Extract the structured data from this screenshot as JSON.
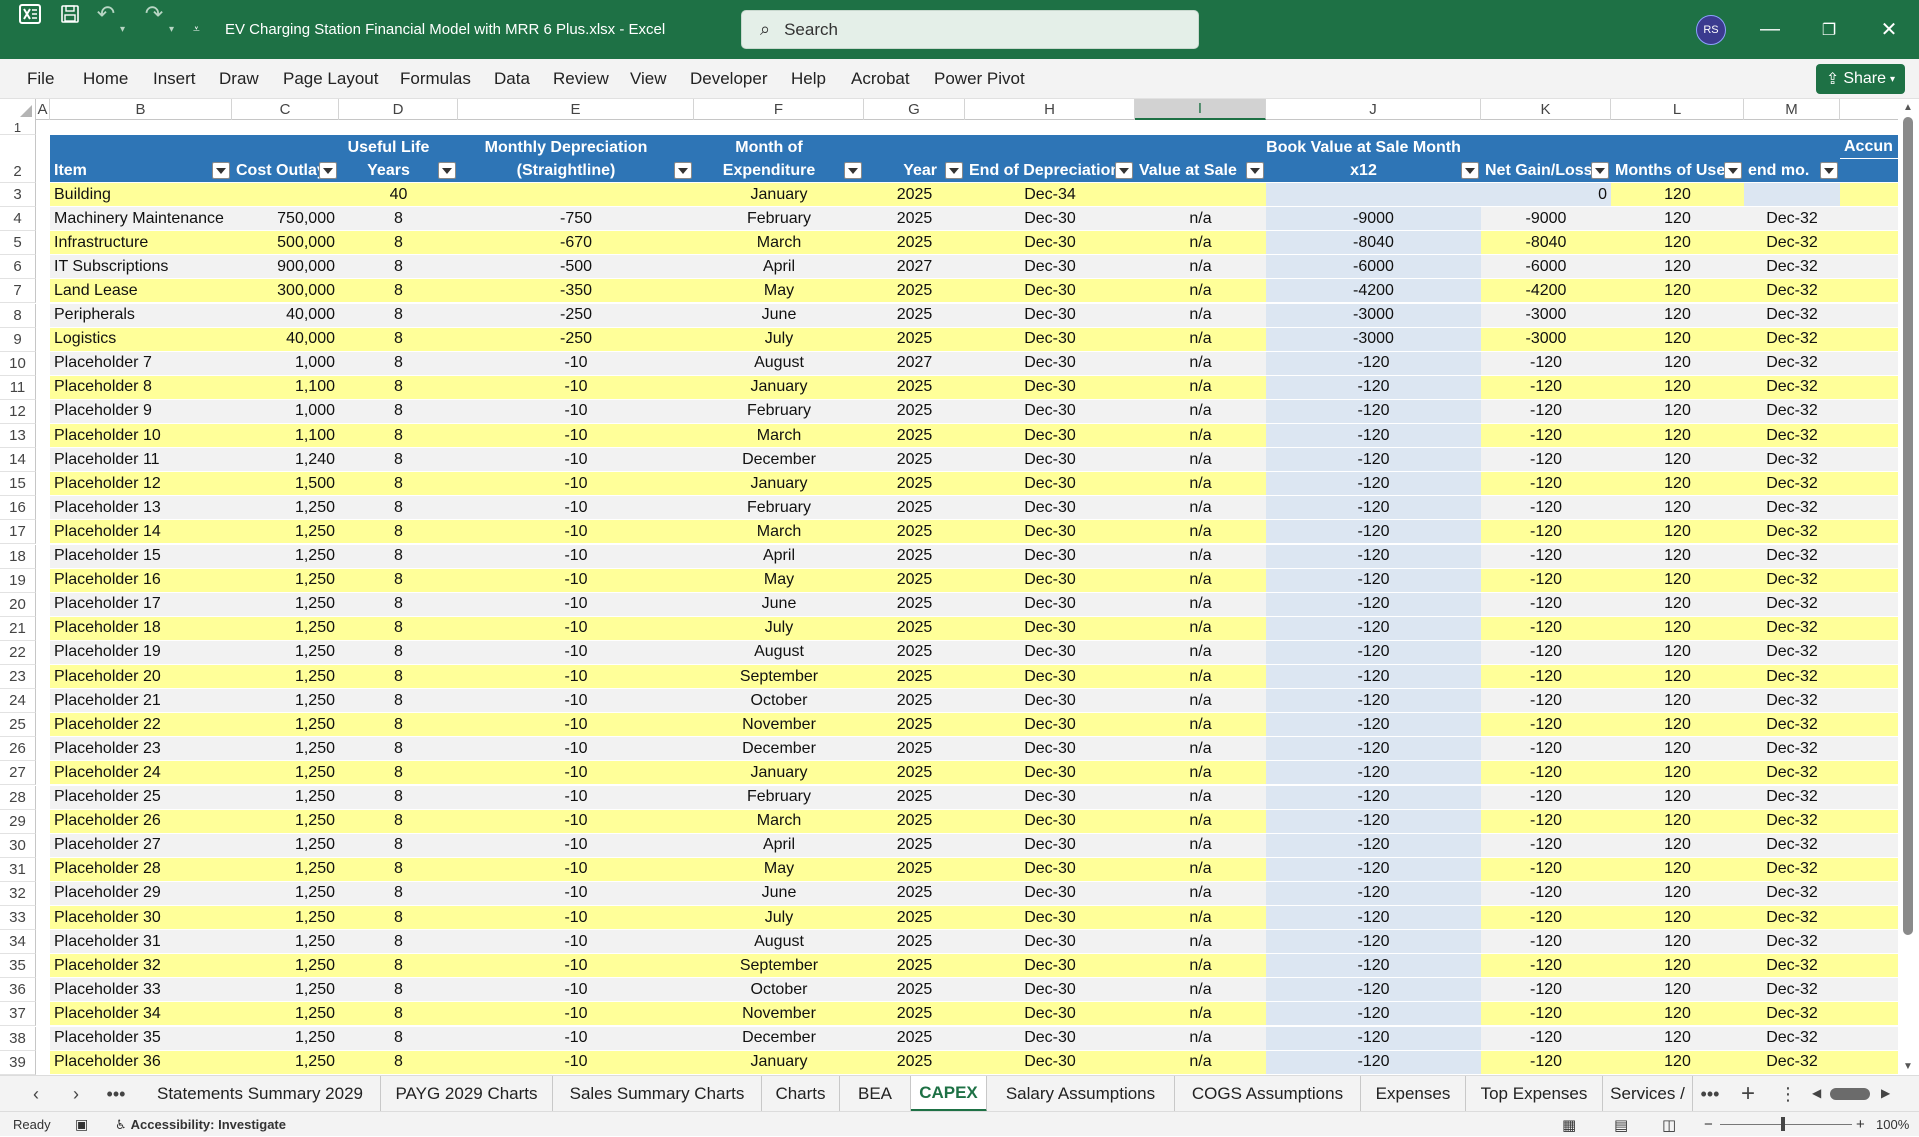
{
  "window": {
    "title": "EV Charging Station Financial Model with MRR 6 Plus.xlsx  -  Excel",
    "search_placeholder": "Search",
    "user_initials": "RS"
  },
  "menu": [
    "File",
    "Home",
    "Insert",
    "Draw",
    "Page Layout",
    "Formulas",
    "Data",
    "Review",
    "View",
    "Developer",
    "Help",
    "Acrobat",
    "Power Pivot"
  ],
  "share_label": "Share",
  "columns": [
    "A",
    "B",
    "C",
    "D",
    "E",
    "F",
    "G",
    "H",
    "I",
    "J",
    "K",
    "L",
    "M"
  ],
  "selected_column": "I",
  "header": {
    "item": "Item",
    "cost": "Cost Outlay",
    "life1": "Useful Life",
    "life2": "Years",
    "dep1": "Monthly Depreciation",
    "dep2": "(Straightline)",
    "month1": "Month of",
    "month2": "Expenditure",
    "year": "Year",
    "end": "End of Depreciation",
    "sale": "Value at Sale",
    "book1": "Book Value at Sale Month",
    "book2": "x12",
    "gain": "Net Gain/Loss",
    "months": "Months of Use",
    "endmo": "end mo.",
    "accum": "Accun"
  },
  "rows": [
    {
      "n": "3",
      "item": "Building",
      "cost": "",
      "life": "40",
      "dep": "",
      "month": "January",
      "year": "2025",
      "end": "Dec-34",
      "sale": "",
      "book": "",
      "gain": "0",
      "months": "120",
      "endmo": ""
    },
    {
      "n": "4",
      "item": "Machinery Maintenance",
      "cost": "750,000",
      "life": "8",
      "dep": "-750",
      "month": "February",
      "year": "2025",
      "end": "Dec-30",
      "sale": "n/a",
      "book": "-9000",
      "gain": "-9000",
      "months": "120",
      "endmo": "Dec-32"
    },
    {
      "n": "5",
      "item": "Infrastructure",
      "cost": "500,000",
      "life": "8",
      "dep": "-670",
      "month": "March",
      "year": "2025",
      "end": "Dec-30",
      "sale": "n/a",
      "book": "-8040",
      "gain": "-8040",
      "months": "120",
      "endmo": "Dec-32"
    },
    {
      "n": "6",
      "item": "IT Subscriptions",
      "cost": "900,000",
      "life": "8",
      "dep": "-500",
      "month": "April",
      "year": "2027",
      "end": "Dec-30",
      "sale": "n/a",
      "book": "-6000",
      "gain": "-6000",
      "months": "120",
      "endmo": "Dec-32"
    },
    {
      "n": "7",
      "item": "Land Lease",
      "cost": "300,000",
      "life": "8",
      "dep": "-350",
      "month": "May",
      "year": "2025",
      "end": "Dec-30",
      "sale": "n/a",
      "book": "-4200",
      "gain": "-4200",
      "months": "120",
      "endmo": "Dec-32"
    },
    {
      "n": "8",
      "item": "Peripherals",
      "cost": "40,000",
      "life": "8",
      "dep": "-250",
      "month": "June",
      "year": "2025",
      "end": "Dec-30",
      "sale": "n/a",
      "book": "-3000",
      "gain": "-3000",
      "months": "120",
      "endmo": "Dec-32"
    },
    {
      "n": "9",
      "item": "Logistics",
      "cost": "40,000",
      "life": "8",
      "dep": "-250",
      "month": "July",
      "year": "2025",
      "end": "Dec-30",
      "sale": "n/a",
      "book": "-3000",
      "gain": "-3000",
      "months": "120",
      "endmo": "Dec-32"
    },
    {
      "n": "10",
      "item": "Placeholder 7",
      "cost": "1,000",
      "life": "8",
      "dep": "-10",
      "month": "August",
      "year": "2027",
      "end": "Dec-30",
      "sale": "n/a",
      "book": "-120",
      "gain": "-120",
      "months": "120",
      "endmo": "Dec-32"
    },
    {
      "n": "11",
      "item": "Placeholder 8",
      "cost": "1,100",
      "life": "8",
      "dep": "-10",
      "month": "January",
      "year": "2025",
      "end": "Dec-30",
      "sale": "n/a",
      "book": "-120",
      "gain": "-120",
      "months": "120",
      "endmo": "Dec-32"
    },
    {
      "n": "12",
      "item": "Placeholder 9",
      "cost": "1,000",
      "life": "8",
      "dep": "-10",
      "month": "February",
      "year": "2025",
      "end": "Dec-30",
      "sale": "n/a",
      "book": "-120",
      "gain": "-120",
      "months": "120",
      "endmo": "Dec-32"
    },
    {
      "n": "13",
      "item": "Placeholder 10",
      "cost": "1,100",
      "life": "8",
      "dep": "-10",
      "month": "March",
      "year": "2025",
      "end": "Dec-30",
      "sale": "n/a",
      "book": "-120",
      "gain": "-120",
      "months": "120",
      "endmo": "Dec-32"
    },
    {
      "n": "14",
      "item": "Placeholder 11",
      "cost": "1,240",
      "life": "8",
      "dep": "-10",
      "month": "December",
      "year": "2025",
      "end": "Dec-30",
      "sale": "n/a",
      "book": "-120",
      "gain": "-120",
      "months": "120",
      "endmo": "Dec-32"
    },
    {
      "n": "15",
      "item": "Placeholder 12",
      "cost": "1,500",
      "life": "8",
      "dep": "-10",
      "month": "January",
      "year": "2025",
      "end": "Dec-30",
      "sale": "n/a",
      "book": "-120",
      "gain": "-120",
      "months": "120",
      "endmo": "Dec-32"
    },
    {
      "n": "16",
      "item": "Placeholder 13",
      "cost": "1,250",
      "life": "8",
      "dep": "-10",
      "month": "February",
      "year": "2025",
      "end": "Dec-30",
      "sale": "n/a",
      "book": "-120",
      "gain": "-120",
      "months": "120",
      "endmo": "Dec-32"
    },
    {
      "n": "17",
      "item": "Placeholder 14",
      "cost": "1,250",
      "life": "8",
      "dep": "-10",
      "month": "March",
      "year": "2025",
      "end": "Dec-30",
      "sale": "n/a",
      "book": "-120",
      "gain": "-120",
      "months": "120",
      "endmo": "Dec-32"
    },
    {
      "n": "18",
      "item": "Placeholder 15",
      "cost": "1,250",
      "life": "8",
      "dep": "-10",
      "month": "April",
      "year": "2025",
      "end": "Dec-30",
      "sale": "n/a",
      "book": "-120",
      "gain": "-120",
      "months": "120",
      "endmo": "Dec-32"
    },
    {
      "n": "19",
      "item": "Placeholder 16",
      "cost": "1,250",
      "life": "8",
      "dep": "-10",
      "month": "May",
      "year": "2025",
      "end": "Dec-30",
      "sale": "n/a",
      "book": "-120",
      "gain": "-120",
      "months": "120",
      "endmo": "Dec-32"
    },
    {
      "n": "20",
      "item": "Placeholder 17",
      "cost": "1,250",
      "life": "8",
      "dep": "-10",
      "month": "June",
      "year": "2025",
      "end": "Dec-30",
      "sale": "n/a",
      "book": "-120",
      "gain": "-120",
      "months": "120",
      "endmo": "Dec-32"
    },
    {
      "n": "21",
      "item": "Placeholder 18",
      "cost": "1,250",
      "life": "8",
      "dep": "-10",
      "month": "July",
      "year": "2025",
      "end": "Dec-30",
      "sale": "n/a",
      "book": "-120",
      "gain": "-120",
      "months": "120",
      "endmo": "Dec-32"
    },
    {
      "n": "22",
      "item": "Placeholder 19",
      "cost": "1,250",
      "life": "8",
      "dep": "-10",
      "month": "August",
      "year": "2025",
      "end": "Dec-30",
      "sale": "n/a",
      "book": "-120",
      "gain": "-120",
      "months": "120",
      "endmo": "Dec-32"
    },
    {
      "n": "23",
      "item": "Placeholder 20",
      "cost": "1,250",
      "life": "8",
      "dep": "-10",
      "month": "September",
      "year": "2025",
      "end": "Dec-30",
      "sale": "n/a",
      "book": "-120",
      "gain": "-120",
      "months": "120",
      "endmo": "Dec-32"
    },
    {
      "n": "24",
      "item": "Placeholder 21",
      "cost": "1,250",
      "life": "8",
      "dep": "-10",
      "month": "October",
      "year": "2025",
      "end": "Dec-30",
      "sale": "n/a",
      "book": "-120",
      "gain": "-120",
      "months": "120",
      "endmo": "Dec-32"
    },
    {
      "n": "25",
      "item": "Placeholder 22",
      "cost": "1,250",
      "life": "8",
      "dep": "-10",
      "month": "November",
      "year": "2025",
      "end": "Dec-30",
      "sale": "n/a",
      "book": "-120",
      "gain": "-120",
      "months": "120",
      "endmo": "Dec-32"
    },
    {
      "n": "26",
      "item": "Placeholder 23",
      "cost": "1,250",
      "life": "8",
      "dep": "-10",
      "month": "December",
      "year": "2025",
      "end": "Dec-30",
      "sale": "n/a",
      "book": "-120",
      "gain": "-120",
      "months": "120",
      "endmo": "Dec-32"
    },
    {
      "n": "27",
      "item": "Placeholder 24",
      "cost": "1,250",
      "life": "8",
      "dep": "-10",
      "month": "January",
      "year": "2025",
      "end": "Dec-30",
      "sale": "n/a",
      "book": "-120",
      "gain": "-120",
      "months": "120",
      "endmo": "Dec-32"
    },
    {
      "n": "28",
      "item": "Placeholder 25",
      "cost": "1,250",
      "life": "8",
      "dep": "-10",
      "month": "February",
      "year": "2025",
      "end": "Dec-30",
      "sale": "n/a",
      "book": "-120",
      "gain": "-120",
      "months": "120",
      "endmo": "Dec-32"
    },
    {
      "n": "29",
      "item": "Placeholder 26",
      "cost": "1,250",
      "life": "8",
      "dep": "-10",
      "month": "March",
      "year": "2025",
      "end": "Dec-30",
      "sale": "n/a",
      "book": "-120",
      "gain": "-120",
      "months": "120",
      "endmo": "Dec-32"
    },
    {
      "n": "30",
      "item": "Placeholder 27",
      "cost": "1,250",
      "life": "8",
      "dep": "-10",
      "month": "April",
      "year": "2025",
      "end": "Dec-30",
      "sale": "n/a",
      "book": "-120",
      "gain": "-120",
      "months": "120",
      "endmo": "Dec-32"
    },
    {
      "n": "31",
      "item": "Placeholder 28",
      "cost": "1,250",
      "life": "8",
      "dep": "-10",
      "month": "May",
      "year": "2025",
      "end": "Dec-30",
      "sale": "n/a",
      "book": "-120",
      "gain": "-120",
      "months": "120",
      "endmo": "Dec-32"
    },
    {
      "n": "32",
      "item": "Placeholder 29",
      "cost": "1,250",
      "life": "8",
      "dep": "-10",
      "month": "June",
      "year": "2025",
      "end": "Dec-30",
      "sale": "n/a",
      "book": "-120",
      "gain": "-120",
      "months": "120",
      "endmo": "Dec-32"
    },
    {
      "n": "33",
      "item": "Placeholder 30",
      "cost": "1,250",
      "life": "8",
      "dep": "-10",
      "month": "July",
      "year": "2025",
      "end": "Dec-30",
      "sale": "n/a",
      "book": "-120",
      "gain": "-120",
      "months": "120",
      "endmo": "Dec-32"
    },
    {
      "n": "34",
      "item": "Placeholder 31",
      "cost": "1,250",
      "life": "8",
      "dep": "-10",
      "month": "August",
      "year": "2025",
      "end": "Dec-30",
      "sale": "n/a",
      "book": "-120",
      "gain": "-120",
      "months": "120",
      "endmo": "Dec-32"
    },
    {
      "n": "35",
      "item": "Placeholder 32",
      "cost": "1,250",
      "life": "8",
      "dep": "-10",
      "month": "September",
      "year": "2025",
      "end": "Dec-30",
      "sale": "n/a",
      "book": "-120",
      "gain": "-120",
      "months": "120",
      "endmo": "Dec-32"
    },
    {
      "n": "36",
      "item": "Placeholder 33",
      "cost": "1,250",
      "life": "8",
      "dep": "-10",
      "month": "October",
      "year": "2025",
      "end": "Dec-30",
      "sale": "n/a",
      "book": "-120",
      "gain": "-120",
      "months": "120",
      "endmo": "Dec-32"
    },
    {
      "n": "37",
      "item": "Placeholder 34",
      "cost": "1,250",
      "life": "8",
      "dep": "-10",
      "month": "November",
      "year": "2025",
      "end": "Dec-30",
      "sale": "n/a",
      "book": "-120",
      "gain": "-120",
      "months": "120",
      "endmo": "Dec-32"
    },
    {
      "n": "38",
      "item": "Placeholder 35",
      "cost": "1,250",
      "life": "8",
      "dep": "-10",
      "month": "December",
      "year": "2025",
      "end": "Dec-30",
      "sale": "n/a",
      "book": "-120",
      "gain": "-120",
      "months": "120",
      "endmo": "Dec-32"
    },
    {
      "n": "39",
      "item": "Placeholder 36",
      "cost": "1,250",
      "life": "8",
      "dep": "-10",
      "month": "January",
      "year": "2025",
      "end": "Dec-30",
      "sale": "n/a",
      "book": "-120",
      "gain": "-120",
      "months": "120",
      "endmo": "Dec-32"
    }
  ],
  "sheet_tabs": [
    "Statements Summary 2029",
    "PAYG 2029 Charts",
    "Sales Summary Charts",
    "Charts",
    "BEA",
    "CAPEX",
    "Salary Assumptions",
    "COGS Assumptions",
    "Expenses",
    "Top Expenses",
    "Services /"
  ],
  "active_tab": "CAPEX",
  "status": {
    "ready": "Ready",
    "accessibility": "Accessibility: Investigate",
    "zoom": "100%"
  },
  "colors": {
    "title_bar": "#1e7145",
    "table_header": "#2e75b6",
    "band_yellow": "#ffff99",
    "band_blue": "#dce6f2"
  }
}
